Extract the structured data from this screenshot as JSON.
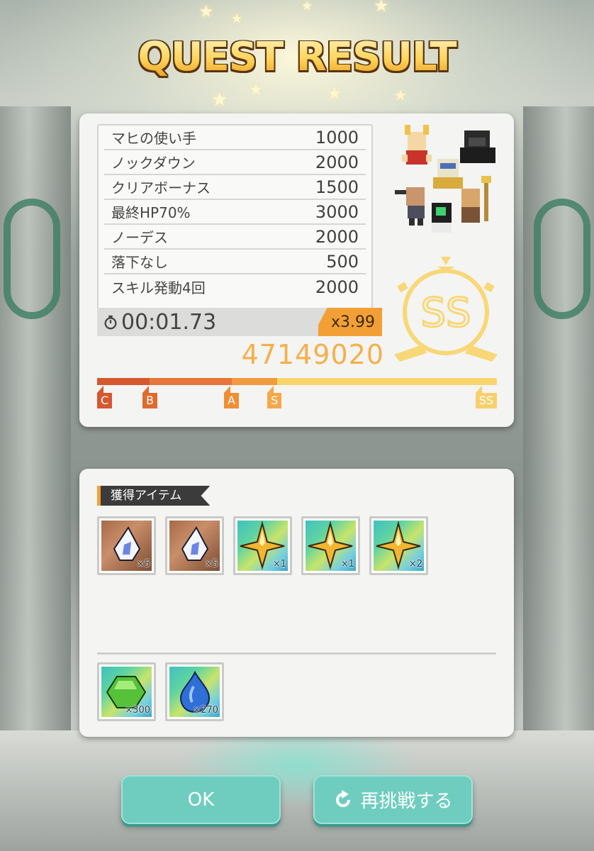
{
  "title": "QUEST RESULT",
  "scores": [
    {
      "label": "マヒの使い手",
      "value": "1000"
    },
    {
      "label": "ノックダウン",
      "value": "2000"
    },
    {
      "label": "クリアボーナス",
      "value": "1500"
    },
    {
      "label": "最終HP70%",
      "value": "3000"
    },
    {
      "label": "ノーデス",
      "value": "2000"
    },
    {
      "label": "落下なし",
      "value": "500"
    },
    {
      "label": "スキル発動4回",
      "value": "2000"
    }
  ],
  "timer": "00:01.73",
  "multiplier": "x3.99",
  "total_score": "47149020",
  "rank": "SS",
  "rank_markers": {
    "c": "C",
    "b": "B",
    "a": "A",
    "s": "S",
    "ss": "SS"
  },
  "rank_progress": 1.0,
  "items_section": {
    "label": "獲得アイテム",
    "items": [
      {
        "icon": "white-gem-icon",
        "qty": "×5"
      },
      {
        "icon": "white-gem-icon",
        "qty": "×5"
      },
      {
        "icon": "gold-star-icon",
        "qty": "×1"
      },
      {
        "icon": "gold-star-icon",
        "qty": "×1"
      },
      {
        "icon": "gold-star-icon",
        "qty": "×2"
      }
    ],
    "currency": [
      {
        "icon": "green-crystal-icon",
        "qty": "×300"
      },
      {
        "icon": "blue-drop-icon",
        "qty": "×270"
      }
    ]
  },
  "buttons": {
    "ok": "OK",
    "retry": "再挑戦する"
  },
  "colors": {
    "accent": "#f2a036",
    "button": "#6fcdbf",
    "rank_gold": "#f8d06b",
    "title_gold": "#ffd45a"
  }
}
